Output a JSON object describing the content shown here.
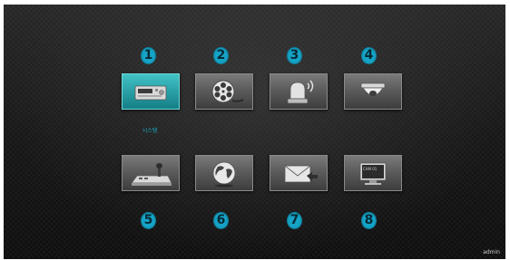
{
  "menu": {
    "items": [
      {
        "number": "1",
        "icon": "dvr-recorder-icon",
        "label": "시스템",
        "selected": true
      },
      {
        "number": "2",
        "icon": "film-reel-icon",
        "label": "",
        "selected": false
      },
      {
        "number": "3",
        "icon": "alarm-siren-icon",
        "label": "",
        "selected": false
      },
      {
        "number": "4",
        "icon": "dome-camera-icon",
        "label": "",
        "selected": false
      },
      {
        "number": "5",
        "icon": "ptz-joystick-icon",
        "label": "",
        "selected": false
      },
      {
        "number": "6",
        "icon": "globe-network-icon",
        "label": "",
        "selected": false
      },
      {
        "number": "7",
        "icon": "email-notification-icon",
        "label": "",
        "selected": false
      },
      {
        "number": "8",
        "icon": "monitor-display-icon",
        "label": "",
        "selected": false
      }
    ],
    "monitor_screen_text": "CAM 01"
  },
  "status": {
    "user": "admin"
  },
  "colors": {
    "accent": "#15a3c6",
    "selected_tile": "#2aa0a6",
    "background": "#1a1a1a"
  }
}
